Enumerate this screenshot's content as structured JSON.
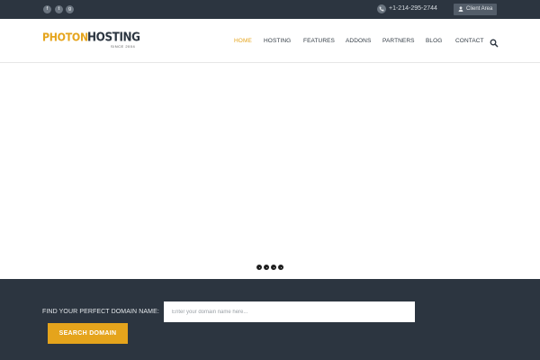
{
  "topbar": {
    "social": [
      {
        "icon": "facebook-icon",
        "glyph": "f"
      },
      {
        "icon": "twitter-icon",
        "glyph": "t"
      },
      {
        "icon": "google-plus-icon",
        "glyph": "g"
      }
    ],
    "phone": "+1-214-295-2744",
    "client_area": "Client Area"
  },
  "logo": {
    "part1": "PHOTON",
    "part2": "HOSTING",
    "since": "SINCE 2004"
  },
  "nav": {
    "items": [
      {
        "label": "HOME",
        "active": true
      },
      {
        "label": "HOSTING",
        "active": false
      },
      {
        "label": "FEATURES",
        "active": false
      },
      {
        "label": "ADDONS",
        "active": false
      },
      {
        "label": "PARTNERS",
        "active": false
      },
      {
        "label": "BLOG",
        "active": false
      },
      {
        "label": "CONTACT",
        "active": false
      }
    ]
  },
  "slider": {
    "slide_count": 4
  },
  "domain": {
    "label": "FIND YOUR PERFECT DOMAIN NAME:",
    "placeholder": "Enter your domain name here...",
    "value": "",
    "button": "SEARCH DOMAIN"
  },
  "colors": {
    "accent": "#e5a41c",
    "dark": "#2c3540",
    "button_dark": "#535d69"
  }
}
